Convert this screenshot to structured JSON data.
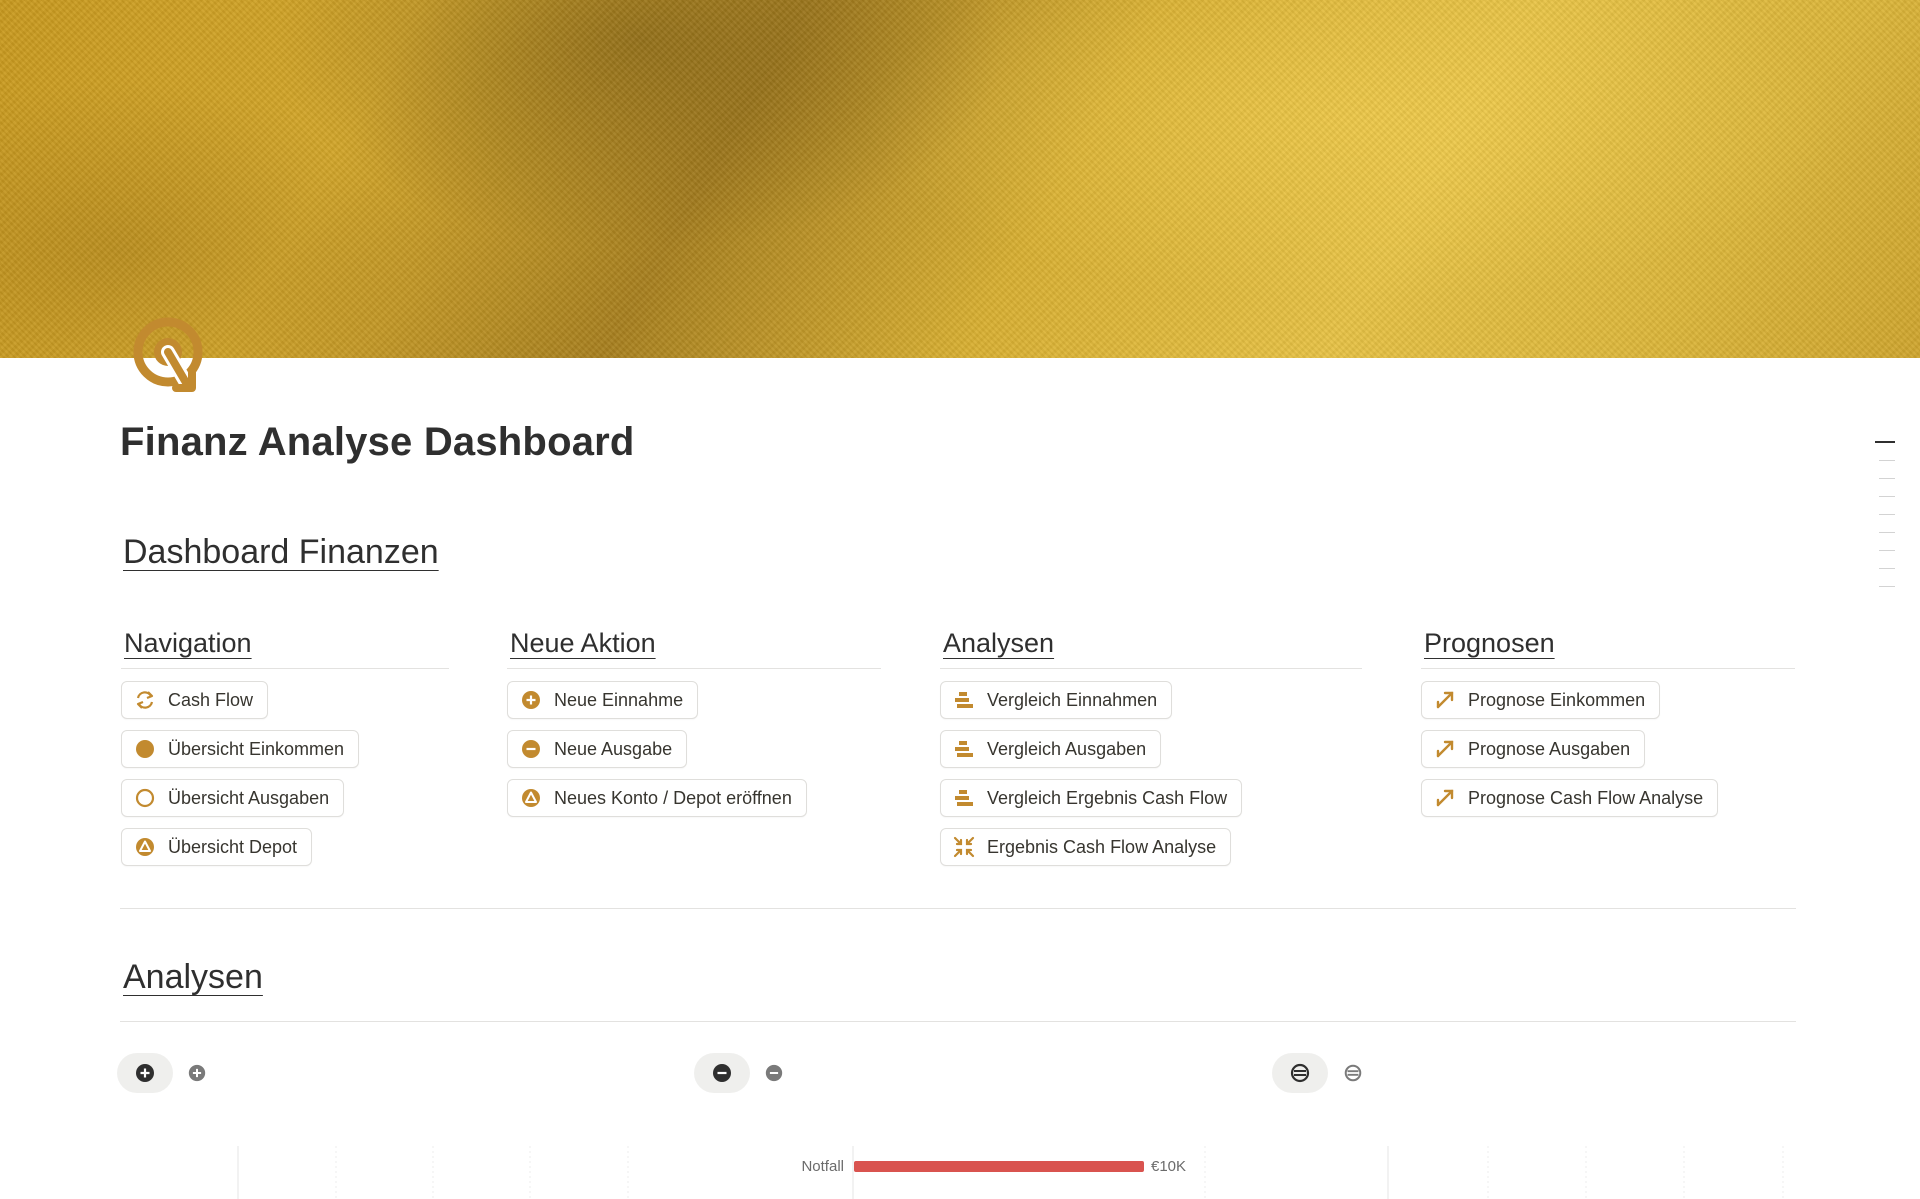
{
  "page": {
    "title": "Finanz Analyse Dashboard",
    "icon": "target-arrow-icon",
    "accent_color": "#c28a2f"
  },
  "dashboard": {
    "heading": "Dashboard Finanzen",
    "columns": [
      {
        "title": "Navigation",
        "buttons": [
          {
            "label": "Cash Flow",
            "icon": "refresh-arrows-icon"
          },
          {
            "label": "Übersicht Einkommen",
            "icon": "filled-circle-icon"
          },
          {
            "label": "Übersicht Ausgaben",
            "icon": "hollow-circle-icon"
          },
          {
            "label": "Übersicht Depot",
            "icon": "triangle-circle-icon"
          }
        ]
      },
      {
        "title": "Neue Aktion",
        "buttons": [
          {
            "label": "Neue Einnahme",
            "icon": "plus-circle-icon"
          },
          {
            "label": "Neue Ausgabe",
            "icon": "minus-circle-icon"
          },
          {
            "label": "Neues Konto / Depot eröffnen",
            "icon": "triangle-circle-icon"
          }
        ]
      },
      {
        "title": "Analysen",
        "buttons": [
          {
            "label": "Vergleich Einnahmen",
            "icon": "stacked-bars-icon"
          },
          {
            "label": "Vergleich Ausgaben",
            "icon": "stacked-bars-icon"
          },
          {
            "label": "Vergleich Ergebnis Cash Flow",
            "icon": "stacked-bars-icon"
          },
          {
            "label": "Ergebnis Cash Flow Analyse",
            "icon": "arrows-in-icon"
          }
        ]
      },
      {
        "title": "Prognosen",
        "buttons": [
          {
            "label": "Prognose Einkommen",
            "icon": "diagonal-arrow-icon"
          },
          {
            "label": "Prognose Ausgaben",
            "icon": "diagonal-arrow-icon"
          },
          {
            "label": "Prognose Cash Flow Analyse",
            "icon": "diagonal-arrow-icon"
          }
        ]
      }
    ]
  },
  "analysen": {
    "heading": "Analysen",
    "view_tabs": [
      {
        "icon": "plus-circle-icon"
      },
      {
        "icon": "minus-circle-icon"
      },
      {
        "icon": "equal-circle-icon"
      }
    ]
  },
  "chart_data": {
    "type": "bar",
    "orientation": "horizontal",
    "categories": [
      "Notfall"
    ],
    "values": [
      10000
    ],
    "value_labels": [
      "€10K"
    ],
    "bar_color": "#d9534f"
  }
}
